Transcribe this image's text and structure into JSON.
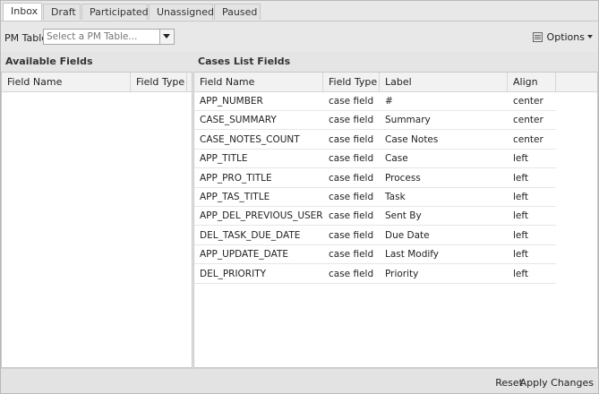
{
  "tabs": [
    {
      "label": "Inbox",
      "active": true
    },
    {
      "label": "Draft",
      "active": false
    },
    {
      "label": "Participated",
      "active": false
    },
    {
      "label": "Unassigned",
      "active": false
    },
    {
      "label": "Paused",
      "active": false
    }
  ],
  "toolbar": {
    "pm_table_label": "PM Table",
    "pm_table_placeholder": "Select a PM Table...",
    "options_label": "Options",
    "options_icon": "list-icon",
    "dropdown_icon": "chevron-down-icon"
  },
  "available_fields": {
    "title": "Available Fields",
    "columns": [
      "Field Name",
      "Field Type"
    ],
    "rows": []
  },
  "cases_list_fields": {
    "title": "Cases List Fields",
    "columns": [
      "Field Name",
      "Field Type",
      "Label",
      "Align"
    ],
    "rows": [
      [
        "APP_NUMBER",
        "case field",
        "#",
        "center"
      ],
      [
        "CASE_SUMMARY",
        "case field",
        "Summary",
        "center"
      ],
      [
        "CASE_NOTES_COUNT",
        "case field",
        "Case Notes",
        "center"
      ],
      [
        "APP_TITLE",
        "case field",
        "Case",
        "left"
      ],
      [
        "APP_PRO_TITLE",
        "case field",
        "Process",
        "left"
      ],
      [
        "APP_TAS_TITLE",
        "case field",
        "Task",
        "left"
      ],
      [
        "APP_DEL_PREVIOUS_USER",
        "case field",
        "Sent By",
        "left"
      ],
      [
        "DEL_TASK_DUE_DATE",
        "case field",
        "Due Date",
        "left"
      ],
      [
        "APP_UPDATE_DATE",
        "case field",
        "Last Modify",
        "left"
      ],
      [
        "DEL_PRIORITY",
        "case field",
        "Priority",
        "left"
      ]
    ]
  },
  "footer": {
    "reset_label": "Reset",
    "apply_label": "Apply Changes"
  }
}
